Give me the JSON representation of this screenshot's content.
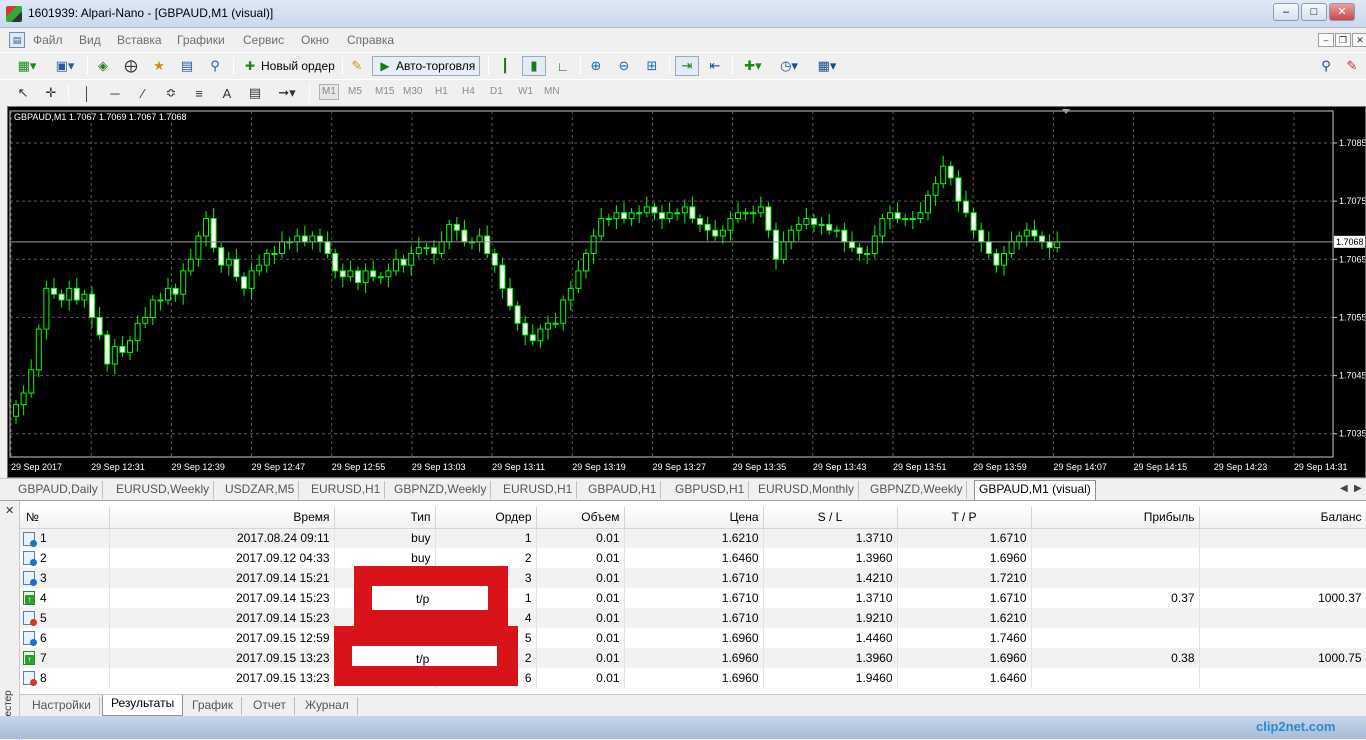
{
  "window": {
    "title": "1601939: Alpari-Nano - [GBPAUD,M1 (visual)]"
  },
  "menu": [
    "Файл",
    "Вид",
    "Вставка",
    "Графики",
    "Сервис",
    "Окно",
    "Справка"
  ],
  "toolbar": {
    "new_order": "Новый ордер",
    "auto_trading": "Авто-торговля"
  },
  "timeframes": [
    "M1",
    "M5",
    "M15",
    "M30",
    "H1",
    "H4",
    "D1",
    "W1",
    "MN"
  ],
  "active_timeframe": "M1",
  "chart_data": {
    "type": "candlestick",
    "title": "GBPAUD,M1 1.7067 1.7069 1.7067 1.7068",
    "ylim": [
      1.7031,
      1.70905
    ],
    "y_ticks": [
      "1.7085",
      "1.7075",
      "1.7065",
      "1.7055",
      "1.7045",
      "1.7035"
    ],
    "current_price": "1.7068",
    "x_ticks": [
      "29 Sep 2017",
      "29 Sep 12:31",
      "29 Sep 12:39",
      "29 Sep 12:47",
      "29 Sep 12:55",
      "29 Sep 13:03",
      "29 Sep 13:11",
      "29 Sep 13:19",
      "29 Sep 13:27",
      "29 Sep 13:35",
      "29 Sep 13:43",
      "29 Sep 13:51",
      "29 Sep 13:59",
      "29 Sep 14:07",
      "29 Sep 14:15",
      "29 Sep 14:23",
      "29 Sep 14:31"
    ],
    "background": "#000000",
    "grid": true,
    "bull_color": "#00ff00",
    "bear_color": "#ffffff",
    "closes": [
      1.704,
      1.7042,
      1.7046,
      1.7053,
      1.706,
      1.7059,
      1.7058,
      1.706,
      1.7058,
      1.7059,
      1.7055,
      1.7052,
      1.7047,
      1.705,
      1.7049,
      1.7051,
      1.7054,
      1.7055,
      1.7058,
      1.7058,
      1.706,
      1.7059,
      1.7063,
      1.7065,
      1.7069,
      1.7072,
      1.7067,
      1.7064,
      1.7065,
      1.7062,
      1.706,
      1.7063,
      1.7064,
      1.7066,
      1.7066,
      1.7068,
      1.7068,
      1.7069,
      1.7068,
      1.7069,
      1.7068,
      1.7066,
      1.7063,
      1.7062,
      1.7063,
      1.7061,
      1.7063,
      1.7062,
      1.7062,
      1.7063,
      1.7065,
      1.7064,
      1.7066,
      1.7067,
      1.7067,
      1.7066,
      1.7068,
      1.7071,
      1.707,
      1.7068,
      1.7068,
      1.7069,
      1.7066,
      1.7064,
      1.706,
      1.7057,
      1.7054,
      1.7052,
      1.7051,
      1.7053,
      1.7054,
      1.7054,
      1.7058,
      1.706,
      1.7063,
      1.7066,
      1.7069,
      1.7072,
      1.7072,
      1.7073,
      1.7072,
      1.7073,
      1.7073,
      1.7074,
      1.7073,
      1.7072,
      1.7073,
      1.7073,
      1.7074,
      1.7072,
      1.7071,
      1.707,
      1.7069,
      1.707,
      1.7072,
      1.7073,
      1.7073,
      1.7073,
      1.7074,
      1.707,
      1.7065,
      1.7068,
      1.707,
      1.7071,
      1.7072,
      1.7071,
      1.7071,
      1.707,
      1.707,
      1.7068,
      1.7067,
      1.7066,
      1.7066,
      1.7069,
      1.7072,
      1.7073,
      1.7072,
      1.7072,
      1.7072,
      1.7073,
      1.7076,
      1.7078,
      1.7081,
      1.7079,
      1.7075,
      1.7073,
      1.707,
      1.7068,
      1.7066,
      1.7064,
      1.7066,
      1.7068,
      1.7069,
      1.707,
      1.7069,
      1.7068,
      1.7067,
      1.7068
    ]
  },
  "chart_tabs": [
    "GBPAUD,Daily",
    "EURUSD,Weekly",
    "USDZAR,M5",
    "EURUSD,H1",
    "GBPNZD,Weekly",
    "EURUSD,H1",
    "GBPAUD,H1",
    "GBPUSD,H1",
    "EURUSD,Monthly",
    "GBPNZD,Weekly",
    "GBPAUD,M1 (visual)"
  ],
  "tester": {
    "side_label": "Тестер",
    "columns": [
      "№",
      "Время",
      "Тип",
      "Ордер",
      "Объем",
      "Цена",
      "S / L",
      "T / P",
      "Прибыль",
      "Баланс"
    ],
    "rows": [
      {
        "icon": "order",
        "n": "1",
        "time": "2017.08.24 09:11",
        "type": "buy",
        "order": "1",
        "volume": "0.01",
        "price": "1.6210",
        "sl": "1.3710",
        "tp": "1.6710",
        "profit": "",
        "balance": ""
      },
      {
        "icon": "order",
        "n": "2",
        "time": "2017.09.12 04:33",
        "type": "buy",
        "order": "2",
        "volume": "0.01",
        "price": "1.6460",
        "sl": "1.3960",
        "tp": "1.6960",
        "profit": "",
        "balance": ""
      },
      {
        "icon": "order",
        "n": "3",
        "time": "2017.09.14 15:21",
        "type": "",
        "order": "3",
        "volume": "0.01",
        "price": "1.6710",
        "sl": "1.4210",
        "tp": "1.7210",
        "profit": "",
        "balance": ""
      },
      {
        "icon": "tp",
        "n": "4",
        "time": "2017.09.14 15:23",
        "type": "t/p",
        "order": "1",
        "volume": "0.01",
        "price": "1.6710",
        "sl": "1.3710",
        "tp": "1.6710",
        "profit": "0.37",
        "balance": "1000.37"
      },
      {
        "icon": "close",
        "n": "5",
        "time": "2017.09.14 15:23",
        "type": "",
        "order": "4",
        "volume": "0.01",
        "price": "1.6710",
        "sl": "1.9210",
        "tp": "1.6210",
        "profit": "",
        "balance": ""
      },
      {
        "icon": "order",
        "n": "6",
        "time": "2017.09.15 12:59",
        "type": "",
        "order": "5",
        "volume": "0.01",
        "price": "1.6960",
        "sl": "1.4460",
        "tp": "1.7460",
        "profit": "",
        "balance": ""
      },
      {
        "icon": "tp",
        "n": "7",
        "time": "2017.09.15 13:23",
        "type": "t/p",
        "order": "2",
        "volume": "0.01",
        "price": "1.6960",
        "sl": "1.3960",
        "tp": "1.6960",
        "profit": "0.38",
        "balance": "1000.75"
      },
      {
        "icon": "close",
        "n": "8",
        "time": "2017.09.15 13:23",
        "type": "",
        "order": "6",
        "volume": "0.01",
        "price": "1.6960",
        "sl": "1.9460",
        "tp": "1.6460",
        "profit": "",
        "balance": ""
      }
    ],
    "tabs": [
      "Настройки",
      "Результаты",
      "График",
      "Отчет",
      "Журнал"
    ],
    "active_tab": "Результаты"
  },
  "watermark": "clip2net.com"
}
